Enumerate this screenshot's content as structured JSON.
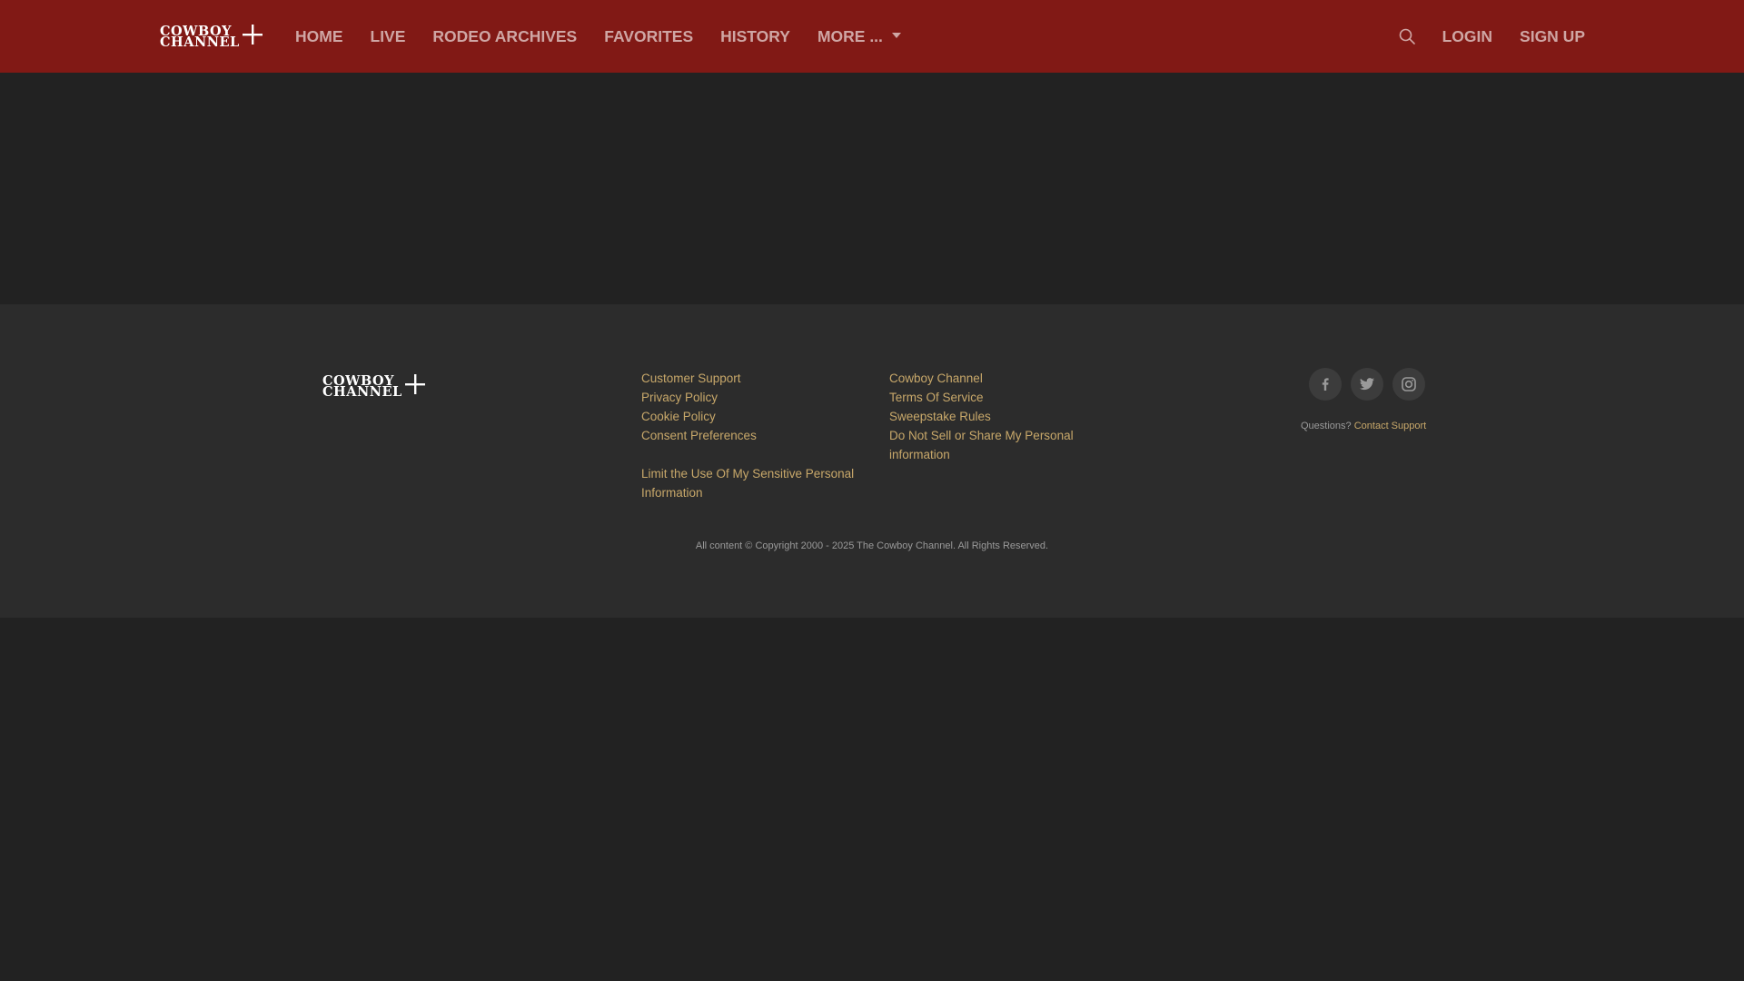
{
  "colors": {
    "header_bg": "#811915",
    "page_bg": "#222222",
    "footer_bg": "#2c2c2c",
    "nav_text": "#cfa6a4",
    "link_gold": "#c8a86a",
    "muted_text": "#9a9a9a"
  },
  "header": {
    "logo": {
      "line1": "COWBOY",
      "line2": "CHANNEL",
      "icon": "plus-icon"
    },
    "nav": [
      {
        "label": "HOME"
      },
      {
        "label": "LIVE"
      },
      {
        "label": "RODEO ARCHIVES"
      },
      {
        "label": "FAVORITES"
      },
      {
        "label": "HISTORY"
      },
      {
        "label": "MORE ...",
        "icon": "caret-down-icon"
      }
    ],
    "search_icon": "search-icon",
    "login_label": "LOGIN",
    "signup_label": "SIGN UP"
  },
  "footer": {
    "logo": {
      "line1": "COWBOY",
      "line2": "CHANNEL",
      "icon": "plus-icon"
    },
    "col1": {
      "links": [
        "Customer Support",
        "Privacy Policy",
        "Cookie Policy",
        "Consent Preferences"
      ],
      "extra_link_line1": "Limit the Use Of My Sensitive Personal",
      "extra_link_line2": "Information"
    },
    "col2": {
      "links": [
        "Cowboy Channel",
        "Terms Of Service",
        "Sweepstake Rules"
      ],
      "extra_link_line1": "Do Not Sell or Share My Personal",
      "extra_link_line2": "information"
    },
    "social": [
      "facebook-icon",
      "twitter-icon",
      "instagram-icon"
    ],
    "questions_label": "Questions?",
    "contact_label": "Contact Support",
    "copyright": "All content © Copyright 2000 - 2025 The Cowboy Channel. All Rights Reserved."
  }
}
